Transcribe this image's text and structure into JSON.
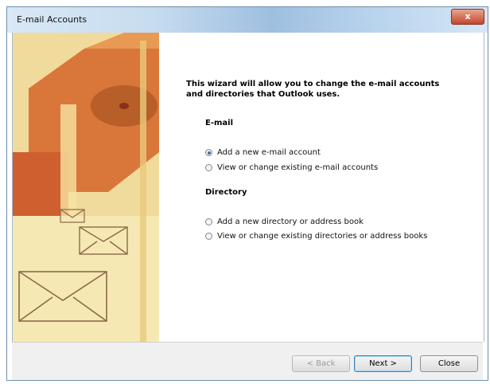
{
  "window": {
    "title": "E-mail Accounts",
    "close_glyph": "x"
  },
  "wizard": {
    "intro": "This wizard will allow you to change the e-mail accounts and directories that Outlook uses.",
    "email_heading": "E-mail",
    "email_options": [
      {
        "label": "Add a new e-mail account",
        "selected": true
      },
      {
        "label": "View or change existing e-mail accounts",
        "selected": false
      }
    ],
    "directory_heading": "Directory",
    "directory_options": [
      {
        "label": "Add a new directory or address book",
        "selected": false
      },
      {
        "label": "View or change existing directories or address books",
        "selected": false
      }
    ]
  },
  "buttons": {
    "back": "< Back",
    "next": "Next >",
    "close": "Close"
  },
  "colors": {
    "art_orange": "#d9773a",
    "art_cream": "#f3e3a8",
    "title_blue": "#9fbfe0"
  }
}
